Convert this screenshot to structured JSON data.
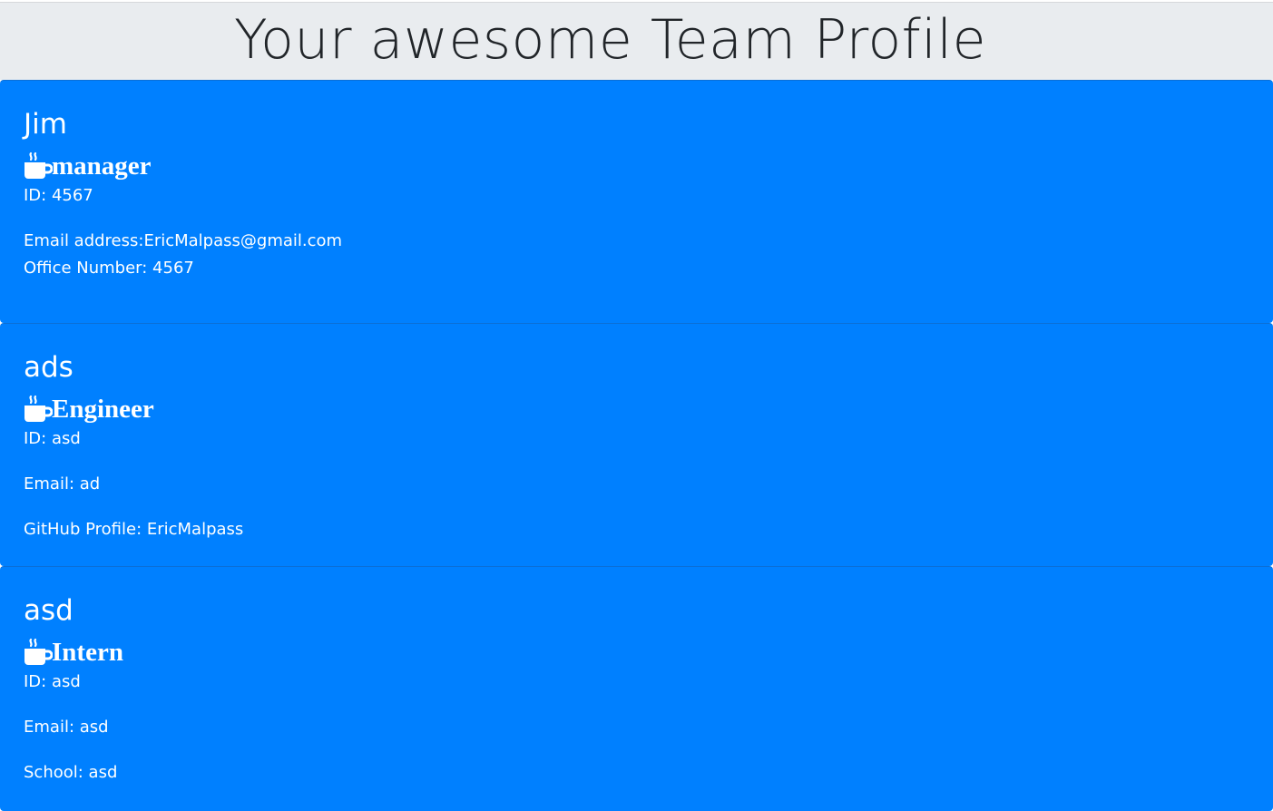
{
  "header": {
    "title": "Your awesome Team Profile"
  },
  "colors": {
    "card_bg": "#0080ff",
    "header_bg": "#e9ecef",
    "text_on_card": "#ffffff"
  },
  "cards": [
    {
      "name": "Jim",
      "role_icon": "mug-hot-icon",
      "role": "manager",
      "id_line": "ID: 4567",
      "line2": "Email address:EricMalpass@gmail.com",
      "line3": "Office Number: 4567"
    },
    {
      "name": "ads",
      "role_icon": "mug-hot-icon",
      "role": "Engineer",
      "id_line": "ID: asd",
      "line2": "Email: ad",
      "line3": "GitHub Profile: EricMalpass"
    },
    {
      "name": "asd",
      "role_icon": "mug-hot-icon",
      "role": "Intern",
      "id_line": "ID: asd",
      "line2": "Email: asd",
      "line3": "School: asd"
    }
  ]
}
